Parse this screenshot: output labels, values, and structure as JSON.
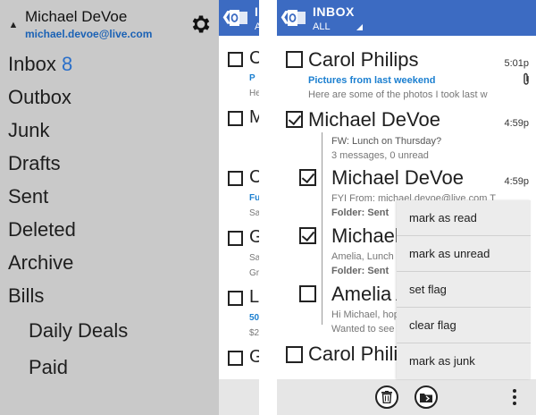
{
  "account": {
    "name": "Michael DeVoe",
    "email": "michael.devoe@live.com",
    "chevron_icon": "chevron-up-icon",
    "settings_icon": "gear-icon"
  },
  "folders": [
    {
      "label": "Inbox",
      "count": "8"
    },
    {
      "label": "Outbox"
    },
    {
      "label": "Junk"
    },
    {
      "label": "Drafts"
    },
    {
      "label": "Sent"
    },
    {
      "label": "Deleted"
    },
    {
      "label": "Archive"
    },
    {
      "label": "Bills"
    },
    {
      "label": "Daily Deals",
      "sub": true
    },
    {
      "label": "Paid",
      "sub": true
    }
  ],
  "middle_panel": {
    "header": {
      "title": "I",
      "sub": "A"
    },
    "rows": [
      {
        "letter": "C",
        "line1": "P",
        "line2": "He"
      },
      {
        "letter": "M"
      },
      {
        "letter": "C",
        "line1": "Fu",
        "line2": "Sa"
      },
      {
        "letter": "G",
        "line1": "Sa",
        "line2": "Gr"
      },
      {
        "letter": "L",
        "line1": "50",
        "line2": "$2"
      },
      {
        "letter": "G"
      }
    ]
  },
  "inbox": {
    "title": "INBOX",
    "filter": "ALL",
    "messages": [
      {
        "sender": "Carol Philips",
        "time": "5:01p",
        "subject": "Pictures from last weekend",
        "preview": "Here are some of the photos I took last w",
        "checked": false
      },
      {
        "sender": "Michael DeVoe",
        "time": "4:59p",
        "subject": "FW: Lunch on Thursday?",
        "preview": "3 messages, 0 unread",
        "checked": true
      },
      {
        "sender": "Michael DeVoe",
        "time": "4:59p",
        "preview": "FYI From: michael.devoe@live.com T",
        "folder": "Folder: Sent",
        "checked": true
      },
      {
        "sender": "Michael",
        "preview": "Amelia,  Lunch",
        "folder": "Folder: Sent",
        "checked": true
      },
      {
        "sender": "Amelia A",
        "preview": "Hi Michael, hop",
        "preview2": "Wanted to see",
        "checked": false
      },
      {
        "sender": "Carol Philip",
        "checked": false
      }
    ]
  },
  "context_menu": [
    "mark as read",
    "mark as unread",
    "set flag",
    "clear flag",
    "mark as junk"
  ],
  "app_bar": {
    "delete_icon": "trash-icon",
    "move_icon": "folder-move-icon",
    "more_icon": "more-vertical-icon"
  },
  "colors": {
    "accent": "#3c6bc2",
    "link": "#1b7fd0",
    "menu_bg": "#c9c9c9"
  }
}
